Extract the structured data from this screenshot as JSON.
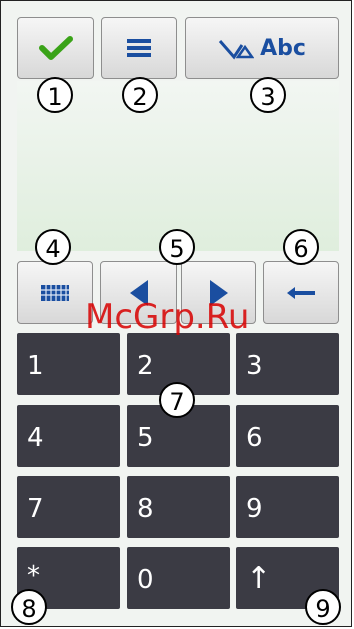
{
  "toolbar": {
    "ok_icon": "checkmark-icon",
    "menu_icon": "menu-lines-icon",
    "input_mode_label": "Abc",
    "input_mode_icon": "handwriting-pen-icon"
  },
  "controls": {
    "keyboard_icon": "keyboard-icon",
    "left_icon": "left-arrow-icon",
    "right_icon": "right-arrow-icon",
    "backspace_icon": "backspace-icon"
  },
  "keypad": {
    "k1": "1",
    "k2": "2",
    "k3": "3",
    "k4": "4",
    "k5": "5",
    "k6": "6",
    "k7": "7",
    "k8": "8",
    "k9": "9",
    "kstar": "*",
    "k0": "0",
    "kshift": "↑"
  },
  "callouts": [
    "1",
    "2",
    "3",
    "4",
    "5",
    "6",
    "7",
    "8",
    "9"
  ],
  "watermark": "McGrp.Ru",
  "colors": {
    "accent_green": "#3aa318",
    "accent_blue": "#1a4ea0",
    "key_bg": "#3b3b44"
  }
}
